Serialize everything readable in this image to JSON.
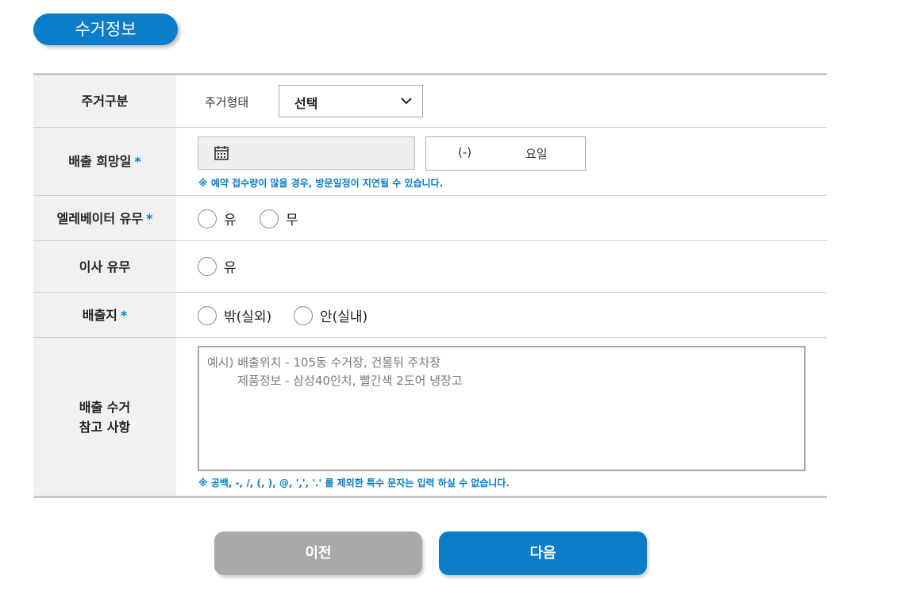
{
  "section_title": "수거정보",
  "rows": {
    "housing": {
      "label": "주거구분",
      "type_label": "주거형태",
      "select_value": "선택"
    },
    "date": {
      "label": "배출 희망일",
      "required_mark": "*",
      "day_paren": "(-)",
      "day_label": "요일",
      "notice": "※ 예약 접수량이 많을 경우, 방문일정이 지연될 수 있습니다."
    },
    "elevator": {
      "label": "엘레베이터 유무",
      "required_mark": "*",
      "options": [
        "유",
        "무"
      ]
    },
    "moving": {
      "label": "이사 유무",
      "options": [
        "유"
      ]
    },
    "location": {
      "label": "배출지",
      "required_mark": "*",
      "options": [
        "밖(실외)",
        "안(실내)"
      ]
    },
    "notes": {
      "label_line1": "배출 수거",
      "label_line2": "참고 사항",
      "placeholder": "예시) 배출위치 - 105동 수거장, 건물뒤 주차장\n        제품정보 - 삼성40인치, 빨간색 2도어 냉장고",
      "notice": "※ 공백, -, /, (, ), @, ',', '.' 를 제외한 특수 문자는 입력 하실 수 없습니다."
    }
  },
  "buttons": {
    "prev": "이전",
    "next": "다음"
  },
  "colors": {
    "accent": "#0a7cc9",
    "label_bg": "#f1f1f1",
    "prev_button": "#a9a9a9"
  },
  "icons": {
    "calendar": "calendar-icon",
    "chevron": "chevron-down-icon"
  }
}
